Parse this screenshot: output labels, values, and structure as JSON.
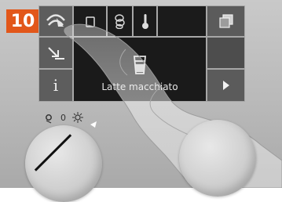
{
  "step": "10",
  "screen": {
    "display_label": "Latte macchiato",
    "buttons": {
      "menu": "menu-arc-icon",
      "down_left": "arrow-down-left-icon",
      "info": "i",
      "copy": "overlap-squares-icon",
      "next": "triangle-right-icon",
      "cup": "cup-icon",
      "beans": "coffee-beans-icon",
      "temp": "thermometer-icon",
      "glass": "latte-glass-icon"
    }
  },
  "dial": {
    "left_marks": [
      "circle",
      "0",
      "sun-icon",
      "arrow"
    ]
  }
}
